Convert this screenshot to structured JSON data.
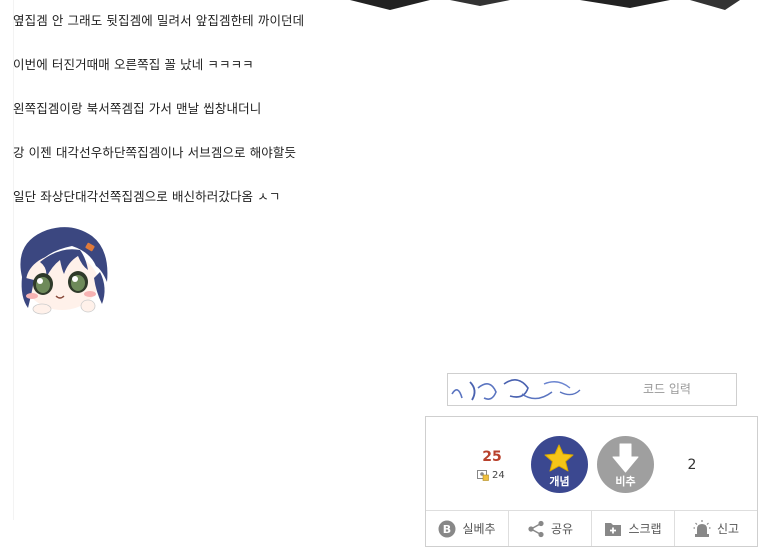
{
  "post": {
    "lines": [
      "옆집겜 안 그래도 뒷집겜에 밀려서 앞집겜한테 까이던데",
      "이번에 터진거때매 오른쪽집 꼴 났네 ㅋㅋㅋㅋ",
      "왼쪽집겜이랑 북서쪽겜집 가서 맨날 씹창내더니",
      "강 이젠 대각선우하단쪽집겜이나 서브겜으로 해야할듯",
      "일단 좌상단대각선쪽집겜으로 배신하러갔다옴 ㅅㄱ"
    ]
  },
  "captcha": {
    "placeholder": "코드 입력"
  },
  "vote": {
    "up_count": "25",
    "fixed_count": "24",
    "up_label": "개념",
    "down_label": "비추",
    "down_count": "2",
    "up_color": "#3b4890",
    "down_color": "#9f9f9f",
    "count_color": "#b8412c"
  },
  "actions": {
    "real_down": "실베추",
    "share": "공유",
    "scrap": "스크랩",
    "report": "신고"
  }
}
